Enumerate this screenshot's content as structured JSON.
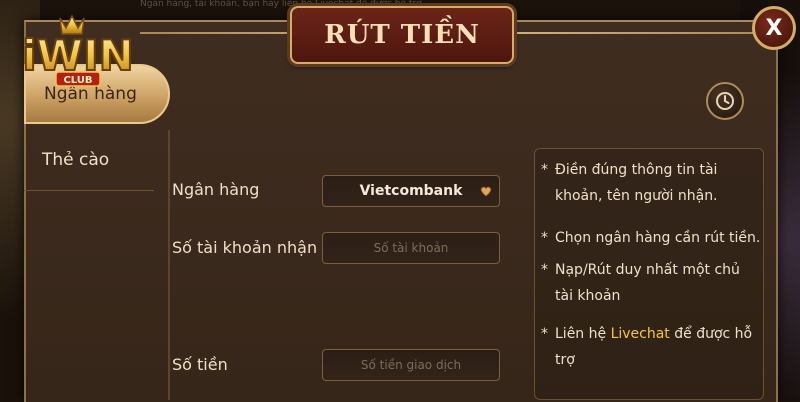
{
  "window": {
    "title": "RÚT TIỀN",
    "close_label": "X",
    "background_hint_text": "Ngân hàng, tài khoản, bạn hãy liên hệ Livechat để được hỗ trợ"
  },
  "logo": {
    "text": "iWIN",
    "badge": "CLUB"
  },
  "sidebar": {
    "tabs": [
      {
        "label": "Ngân hàng",
        "active": true
      },
      {
        "label": "Thẻ cào",
        "active": false
      }
    ]
  },
  "form": {
    "bank_label": "Ngân hàng",
    "bank_value": "Vietcombank",
    "account_label": "Số tài khoản nhận",
    "account_placeholder": "Số tài khoản",
    "amount_label": "Số tiền",
    "amount_placeholder": "Số tiền giao dịch"
  },
  "notes": {
    "bullet": "*",
    "items": [
      "Điền đúng thông tin tài khoản, tên người nhận.",
      "Chọn ngân hàng cần rút tiền.",
      "Nạp/Rút duy nhất một chủ tài khoản"
    ],
    "contact_prefix": "Liên hệ ",
    "contact_link": "Livechat",
    "contact_suffix": " để được hỗ trợ"
  },
  "colors": {
    "accent_gold": "#d6ad68",
    "title_red": "#6b2418",
    "highlight": "#f5c542",
    "panel_brown": "#3f2d20"
  }
}
